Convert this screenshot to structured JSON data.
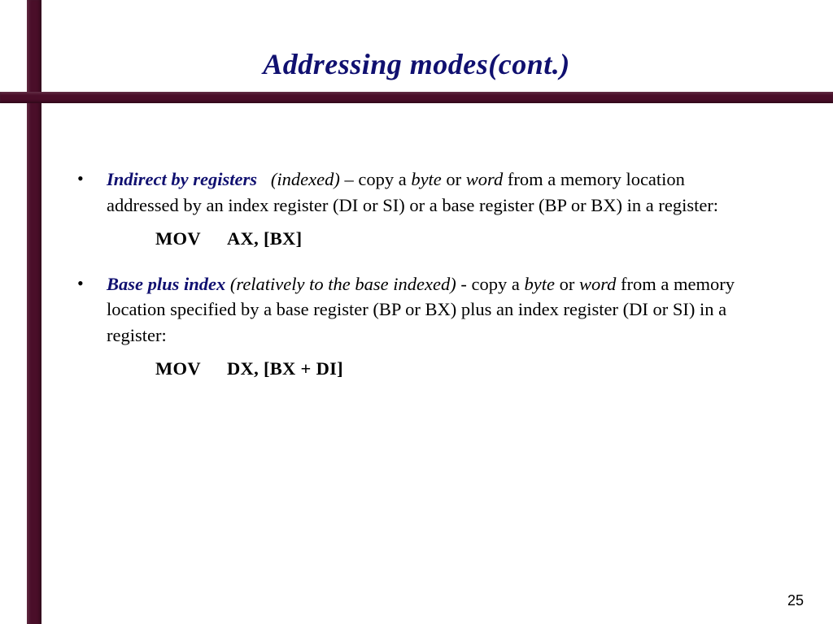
{
  "title": "Addressing modes(cont.)",
  "bullets": [
    {
      "term": "Indirect by registers",
      "paren": "(indexed)",
      "sep": " – ",
      "pre": "copy a ",
      "i1": "byte",
      "mid1": " or ",
      "i2": "word",
      "tail": "  from a memory location addressed by an index register (DI or SI) or a base register (BP or BX) in a register:",
      "code_mnem": "MOV",
      "code_rest": "AX, [BX]"
    },
    {
      "term": "Base plus index",
      "paren": "(relatively to the base indexed)",
      "sep": " -  ",
      "pre": "copy a ",
      "i1": "byte",
      "mid1": " or ",
      "i2": "word",
      "tail": " from a memory location specified by a base register (BP or BX) plus an index register (DI or SI) in a register:",
      "code_mnem": "MOV",
      "code_rest": "DX, [BX + DI]"
    }
  ],
  "page": "25"
}
